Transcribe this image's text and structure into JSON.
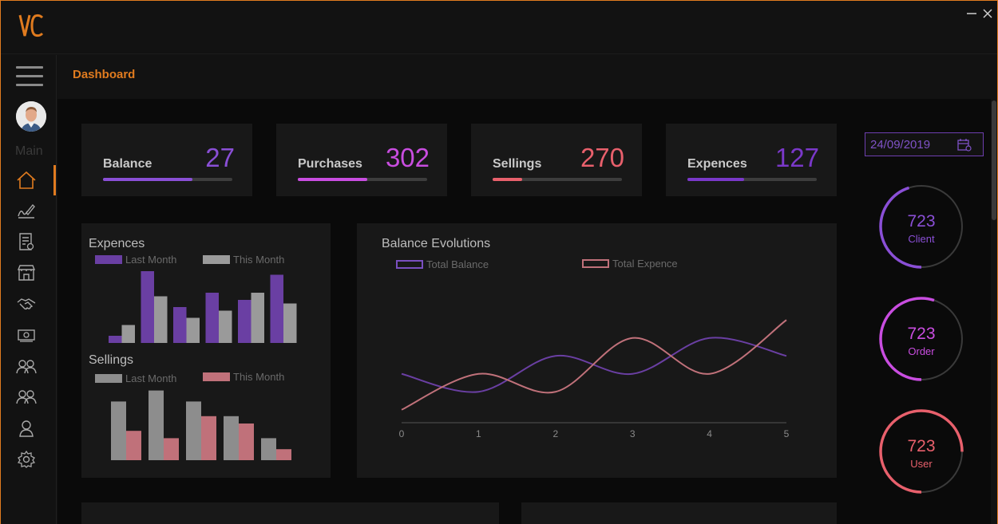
{
  "app": {
    "logo_text": "VC"
  },
  "header": {
    "title": "Dashboard"
  },
  "sidebar": {
    "section_label": "Main",
    "items": [
      {
        "name": "home",
        "icon": "home-icon"
      },
      {
        "name": "sign",
        "icon": "signature-icon"
      },
      {
        "name": "invoice",
        "icon": "invoice-icon"
      },
      {
        "name": "store",
        "icon": "store-icon"
      },
      {
        "name": "deals",
        "icon": "handshake-icon"
      },
      {
        "name": "money",
        "icon": "money-icon"
      },
      {
        "name": "clients",
        "icon": "users-icon"
      },
      {
        "name": "team",
        "icon": "users-icon"
      },
      {
        "name": "profile",
        "icon": "user-icon"
      },
      {
        "name": "settings",
        "icon": "gear-icon"
      }
    ]
  },
  "stats": [
    {
      "label": "Balance",
      "value": "27",
      "progress": 0.69,
      "color": "#8a4fd6"
    },
    {
      "label": "Purchases",
      "value": "302",
      "progress": 0.54,
      "color": "#c94de0"
    },
    {
      "label": "Sellings",
      "value": "270",
      "progress": 0.23,
      "color": "#e8606c"
    },
    {
      "label": "Expences",
      "value": "127",
      "progress": 0.44,
      "color": "#7a38c9"
    }
  ],
  "date": {
    "value": "24/09/2019",
    "icon": "calendar-icon"
  },
  "rings": [
    {
      "value": "723",
      "label": "Client",
      "progress": 0.45,
      "color": "#8a4fd6"
    },
    {
      "value": "723",
      "label": "Order",
      "progress": 0.55,
      "color": "#c94de0"
    },
    {
      "value": "723",
      "label": "User",
      "progress": 0.75,
      "color": "#e8606c"
    }
  ],
  "chart_data": [
    {
      "type": "bar",
      "title": "Expences",
      "series": [
        {
          "name": "Last Month",
          "values": [
            1,
            10,
            5,
            7,
            6,
            9.5
          ],
          "color": "#6a3fa3"
        },
        {
          "name": "This Month",
          "values": [
            2.5,
            6.5,
            3.5,
            4.5,
            7,
            5.5
          ],
          "color": "#9a9a9a"
        }
      ]
    },
    {
      "type": "bar",
      "title": "Sellings",
      "series": [
        {
          "name": "Last Month",
          "values": [
            8,
            9.5,
            8,
            6,
            3
          ],
          "color": "#8d8d8d"
        },
        {
          "name": "This Month",
          "values": [
            4,
            3,
            6,
            5,
            1.5
          ],
          "color": "#c0717a"
        }
      ]
    },
    {
      "type": "line",
      "title": "Balance Evolutions",
      "x": [
        0,
        1,
        2,
        3,
        4,
        5
      ],
      "series": [
        {
          "name": "Total Balance",
          "values": [
            3,
            2,
            4,
            3,
            5,
            4
          ],
          "color": "#6a3fa3"
        },
        {
          "name": "Total Expence",
          "values": [
            1,
            3,
            2,
            5,
            3,
            6
          ],
          "color": "#c0717a"
        }
      ]
    }
  ],
  "bottom": {
    "left_title": "",
    "right_title": ""
  }
}
